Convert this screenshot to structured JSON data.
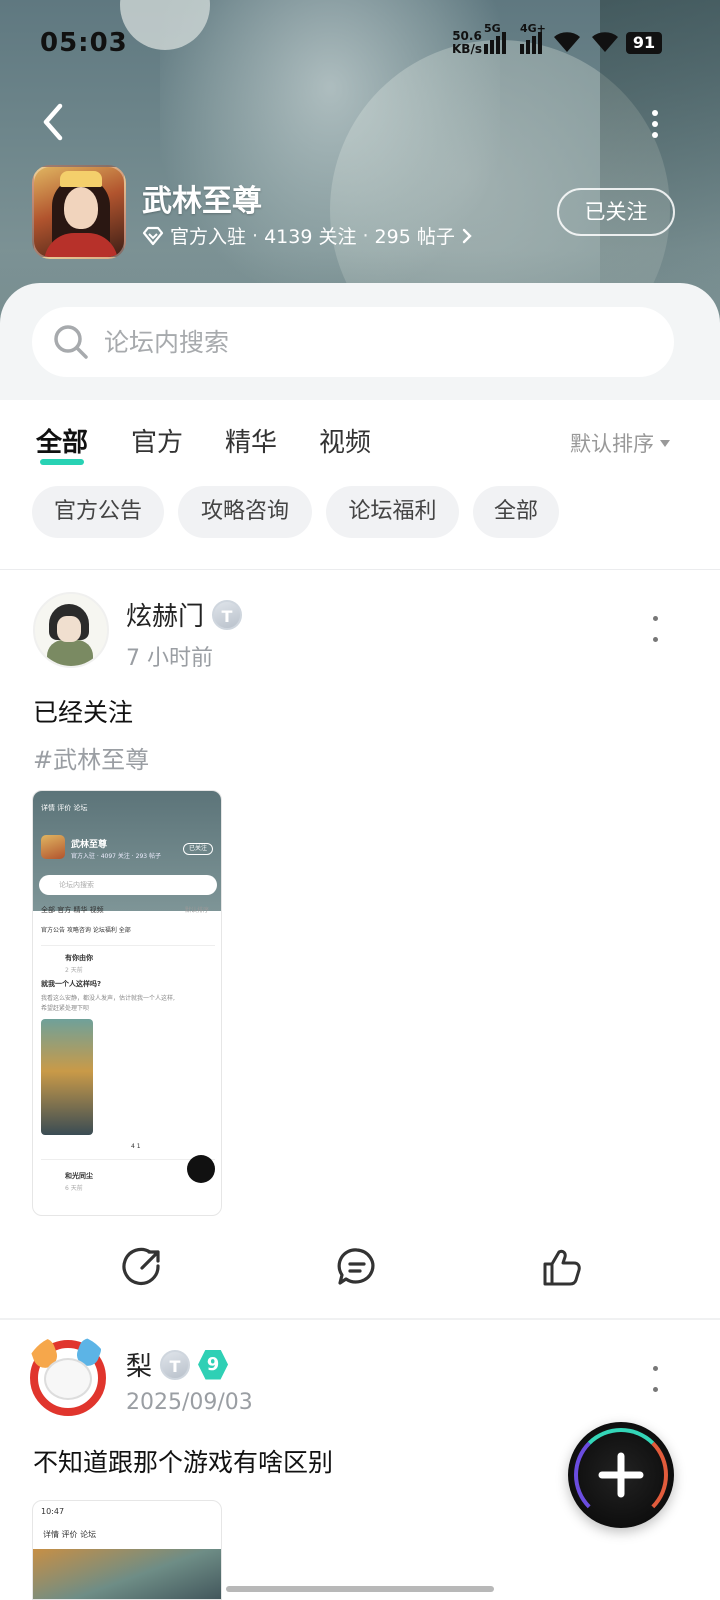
{
  "status_bar": {
    "time": "05:03",
    "net_speed": "50.6",
    "net_unit": "KB/s",
    "sim1_label": "5G",
    "sim2_label": "4G+",
    "battery": "91"
  },
  "header": {
    "game_name": "武林至尊",
    "certified": "官方入驻",
    "followers": "4139 关注",
    "posts": "295 帖子",
    "follow_button": "已关注"
  },
  "search": {
    "placeholder": "论坛内搜索"
  },
  "tabs": [
    {
      "label": "全部",
      "active": true
    },
    {
      "label": "官方",
      "active": false
    },
    {
      "label": "精华",
      "active": false
    },
    {
      "label": "视频",
      "active": false
    }
  ],
  "sort_label": "默认排序",
  "chips": [
    "官方公告",
    "攻略咨询",
    "论坛福利",
    "全部"
  ],
  "posts": [
    {
      "author": "炫赫门",
      "level_badge": "T",
      "time": "7 小时前",
      "text": "已经关注",
      "tag": "#武林至尊",
      "screenshot": {
        "tabs": "详情  评价  论坛",
        "title": "武林至尊",
        "meta": "官方入驻 · 4097 关注 · 293 帖子",
        "follow": "已关注",
        "search": "论坛内搜索",
        "tab_row": "全部   官方   精华   视频",
        "sort": "默认排序",
        "chip_row": "官方公告   攻略咨询   论坛福利   全部",
        "inner_author": "有你由你",
        "inner_time": "2 天前",
        "inner_text": "就我一个人这样吗?",
        "inner_body1": "我看这么安静，都没人发声，估计就我一个人这样,",
        "inner_body2": "希望赶紧处理下呗",
        "inner_stats": "4          1",
        "next_author": "和光同尘",
        "next_time": "6 天前"
      }
    },
    {
      "author": "梨",
      "level_badge": "T",
      "level_number": "9",
      "time": "2025/09/03",
      "text": "不知道跟那个游戏有啥区别",
      "screenshot": {
        "status": "10:47",
        "tabs": "详情  评价  论坛"
      }
    }
  ],
  "colors": {
    "accent": "#28d2b4",
    "muted_text": "#9a9ea3",
    "chip_bg": "#f1f2f4"
  }
}
